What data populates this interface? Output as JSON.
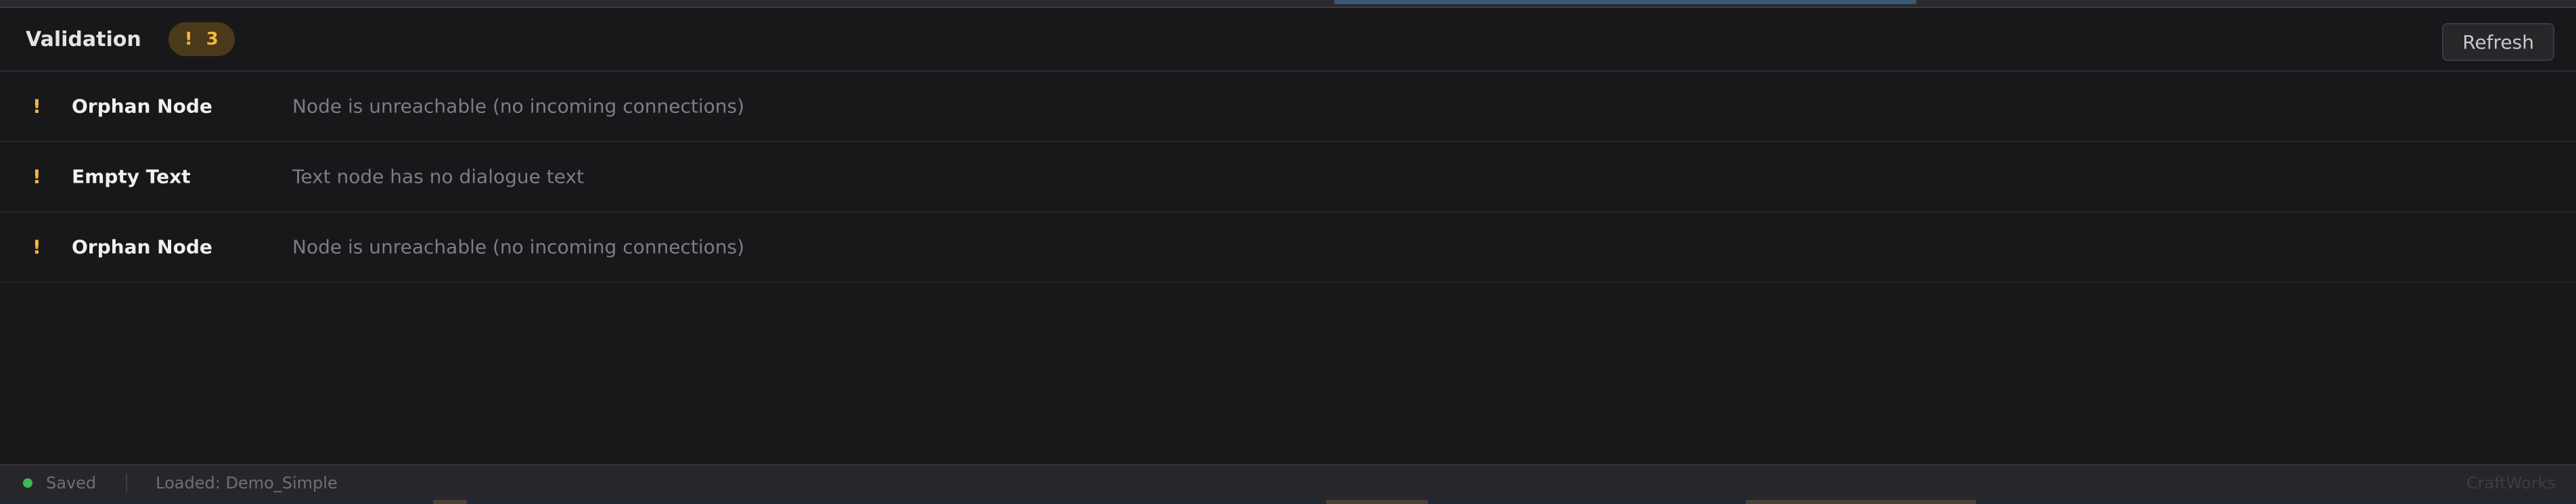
{
  "panel": {
    "title": "Validation",
    "badge": {
      "icon": "warning-icon",
      "glyph": "!",
      "count": "3",
      "color": "#f5b63b"
    },
    "refresh_label": "Refresh"
  },
  "issues": [
    {
      "icon": "warning-icon",
      "glyph": "!",
      "title": "Orphan Node",
      "description": "Node is unreachable (no incoming connections)"
    },
    {
      "icon": "warning-icon",
      "glyph": "!",
      "title": "Empty Text",
      "description": "Text node has no dialogue text"
    },
    {
      "icon": "warning-icon",
      "glyph": "!",
      "title": "Orphan Node",
      "description": "Node is unreachable (no incoming connections)"
    }
  ],
  "status_bar": {
    "saved_label": "Saved",
    "saved_color": "#3fb950",
    "loaded_label": "Loaded: Demo_Simple",
    "brand": "CraftWorks"
  },
  "colors": {
    "background": "#18181b",
    "warning": "#f5b63b",
    "text_primary": "#f0f0f2",
    "text_muted": "#7d7d84"
  }
}
